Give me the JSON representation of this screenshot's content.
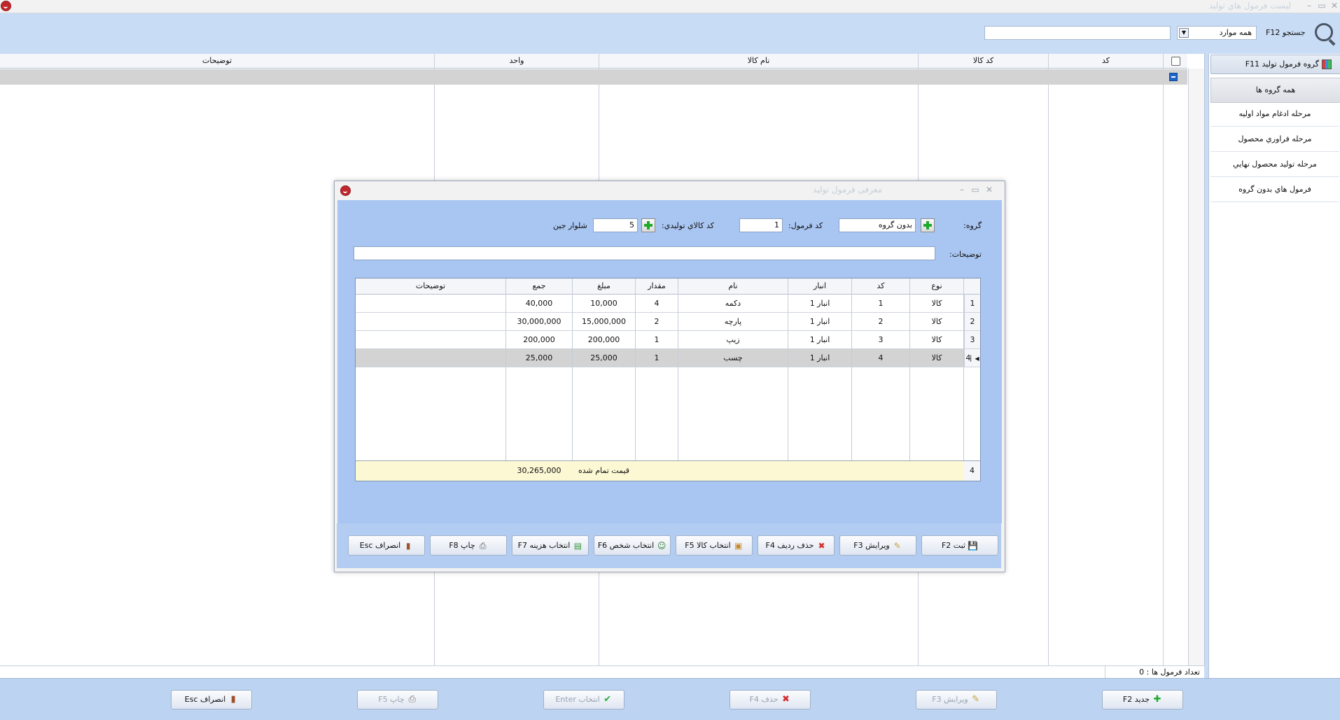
{
  "window": {
    "title": "ليست فرمول هاي توليد"
  },
  "search": {
    "label": "جستجو F12",
    "combo_value": "همه موارد",
    "input_value": ""
  },
  "main_grid": {
    "columns": [
      "کد",
      "کد کالا",
      "نام کالا",
      "واحد",
      "توضیحات"
    ]
  },
  "status": {
    "count_text": "تعداد فرمول ها : 0"
  },
  "side": {
    "header": "گروه فرمول تولید F11",
    "items": [
      "همه گروه ها",
      "مرحله ادغام مواد اولیه",
      "مرحله فراوري محصول",
      "مرحله توليد محصول نهايي",
      "فرمول هاي بدون گروه"
    ]
  },
  "toolbar": {
    "new": "جدید F2",
    "edit": "ویرایش F3",
    "delete": "حذف F4",
    "select": "انتخاب Enter",
    "print": "چاپ F5",
    "cancel": "انصراف Esc"
  },
  "dialog": {
    "title": "معرفی فرمول تولید",
    "group_label": "گروه:",
    "group_value": "بدون گروه",
    "formula_code_label": "کد فرمول:",
    "formula_code_value": "1",
    "product_code_label": "کد کالاي توليدي:",
    "product_code_value": "5",
    "product_name": "شلوار جین",
    "description_label": "توضیحات:",
    "description_value": "",
    "grid": {
      "columns": [
        "نوع",
        "کد",
        "انبار",
        "نام",
        "مقدار",
        "مبلغ",
        "جمع",
        "توضیحات"
      ],
      "rows": [
        {
          "num": "1",
          "type": "کالا",
          "code": "1",
          "store": "انبار 1",
          "name": "دکمه",
          "qty": "4",
          "price": "10,000",
          "total": "40,000",
          "desc": ""
        },
        {
          "num": "2",
          "type": "کالا",
          "code": "2",
          "store": "انبار 1",
          "name": "پارچه",
          "qty": "2",
          "price": "15,000,000",
          "total": "30,000,000",
          "desc": ""
        },
        {
          "num": "3",
          "type": "کالا",
          "code": "3",
          "store": "انبار 1",
          "name": "زیپ",
          "qty": "1",
          "price": "200,000",
          "total": "200,000",
          "desc": ""
        },
        {
          "num": "4",
          "type": "کالا",
          "code": "4",
          "store": "انبار 1",
          "name": "چسب",
          "qty": "1",
          "price": "25,000",
          "total": "25,000",
          "desc": ""
        }
      ],
      "footer": {
        "count": "4",
        "label": "قیمت تمام شده",
        "total": "30,265,000"
      }
    },
    "buttons": {
      "save": "ثبت F2",
      "edit": "ویرایش F3",
      "delete_row": "حذف ردیف F4",
      "select_item": "انتخاب کالا F5",
      "select_person": "انتخاب شخص F6",
      "select_cost": "انتخاب هزینه F7",
      "print": "چاپ F8",
      "cancel": "انصراف Esc"
    }
  },
  "colors": {
    "accent": "#1faa2c",
    "panel": "#a9c6f2",
    "background": "#c9dcf5",
    "selected_row": "#d3d3d3",
    "footer": "#fcf8d4"
  }
}
